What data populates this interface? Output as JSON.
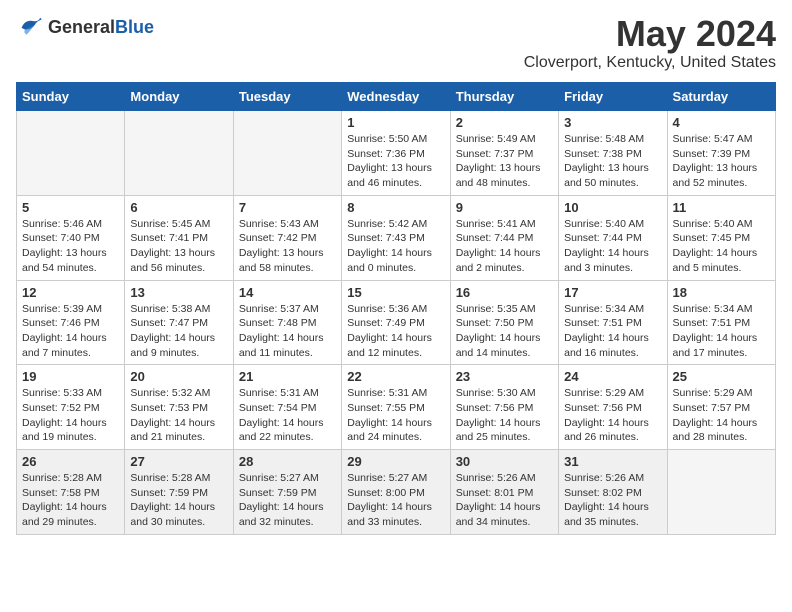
{
  "header": {
    "logo_general": "General",
    "logo_blue": "Blue",
    "month_year": "May 2024",
    "location": "Cloverport, Kentucky, United States"
  },
  "weekdays": [
    "Sunday",
    "Monday",
    "Tuesday",
    "Wednesday",
    "Thursday",
    "Friday",
    "Saturday"
  ],
  "weeks": [
    [
      {
        "day": "",
        "empty": true
      },
      {
        "day": "",
        "empty": true
      },
      {
        "day": "",
        "empty": true
      },
      {
        "day": "1",
        "sunrise": "5:50 AM",
        "sunset": "7:36 PM",
        "daylight": "13 hours and 46 minutes."
      },
      {
        "day": "2",
        "sunrise": "5:49 AM",
        "sunset": "7:37 PM",
        "daylight": "13 hours and 48 minutes."
      },
      {
        "day": "3",
        "sunrise": "5:48 AM",
        "sunset": "7:38 PM",
        "daylight": "13 hours and 50 minutes."
      },
      {
        "day": "4",
        "sunrise": "5:47 AM",
        "sunset": "7:39 PM",
        "daylight": "13 hours and 52 minutes."
      }
    ],
    [
      {
        "day": "5",
        "sunrise": "5:46 AM",
        "sunset": "7:40 PM",
        "daylight": "13 hours and 54 minutes."
      },
      {
        "day": "6",
        "sunrise": "5:45 AM",
        "sunset": "7:41 PM",
        "daylight": "13 hours and 56 minutes."
      },
      {
        "day": "7",
        "sunrise": "5:43 AM",
        "sunset": "7:42 PM",
        "daylight": "13 hours and 58 minutes."
      },
      {
        "day": "8",
        "sunrise": "5:42 AM",
        "sunset": "7:43 PM",
        "daylight": "14 hours and 0 minutes."
      },
      {
        "day": "9",
        "sunrise": "5:41 AM",
        "sunset": "7:44 PM",
        "daylight": "14 hours and 2 minutes."
      },
      {
        "day": "10",
        "sunrise": "5:40 AM",
        "sunset": "7:44 PM",
        "daylight": "14 hours and 3 minutes."
      },
      {
        "day": "11",
        "sunrise": "5:40 AM",
        "sunset": "7:45 PM",
        "daylight": "14 hours and 5 minutes."
      }
    ],
    [
      {
        "day": "12",
        "sunrise": "5:39 AM",
        "sunset": "7:46 PM",
        "daylight": "14 hours and 7 minutes."
      },
      {
        "day": "13",
        "sunrise": "5:38 AM",
        "sunset": "7:47 PM",
        "daylight": "14 hours and 9 minutes."
      },
      {
        "day": "14",
        "sunrise": "5:37 AM",
        "sunset": "7:48 PM",
        "daylight": "14 hours and 11 minutes."
      },
      {
        "day": "15",
        "sunrise": "5:36 AM",
        "sunset": "7:49 PM",
        "daylight": "14 hours and 12 minutes."
      },
      {
        "day": "16",
        "sunrise": "5:35 AM",
        "sunset": "7:50 PM",
        "daylight": "14 hours and 14 minutes."
      },
      {
        "day": "17",
        "sunrise": "5:34 AM",
        "sunset": "7:51 PM",
        "daylight": "14 hours and 16 minutes."
      },
      {
        "day": "18",
        "sunrise": "5:34 AM",
        "sunset": "7:51 PM",
        "daylight": "14 hours and 17 minutes."
      }
    ],
    [
      {
        "day": "19",
        "sunrise": "5:33 AM",
        "sunset": "7:52 PM",
        "daylight": "14 hours and 19 minutes."
      },
      {
        "day": "20",
        "sunrise": "5:32 AM",
        "sunset": "7:53 PM",
        "daylight": "14 hours and 21 minutes."
      },
      {
        "day": "21",
        "sunrise": "5:31 AM",
        "sunset": "7:54 PM",
        "daylight": "14 hours and 22 minutes."
      },
      {
        "day": "22",
        "sunrise": "5:31 AM",
        "sunset": "7:55 PM",
        "daylight": "14 hours and 24 minutes."
      },
      {
        "day": "23",
        "sunrise": "5:30 AM",
        "sunset": "7:56 PM",
        "daylight": "14 hours and 25 minutes."
      },
      {
        "day": "24",
        "sunrise": "5:29 AM",
        "sunset": "7:56 PM",
        "daylight": "14 hours and 26 minutes."
      },
      {
        "day": "25",
        "sunrise": "5:29 AM",
        "sunset": "7:57 PM",
        "daylight": "14 hours and 28 minutes."
      }
    ],
    [
      {
        "day": "26",
        "sunrise": "5:28 AM",
        "sunset": "7:58 PM",
        "daylight": "14 hours and 29 minutes.",
        "lastrow": true
      },
      {
        "day": "27",
        "sunrise": "5:28 AM",
        "sunset": "7:59 PM",
        "daylight": "14 hours and 30 minutes.",
        "lastrow": true
      },
      {
        "day": "28",
        "sunrise": "5:27 AM",
        "sunset": "7:59 PM",
        "daylight": "14 hours and 32 minutes.",
        "lastrow": true
      },
      {
        "day": "29",
        "sunrise": "5:27 AM",
        "sunset": "8:00 PM",
        "daylight": "14 hours and 33 minutes.",
        "lastrow": true
      },
      {
        "day": "30",
        "sunrise": "5:26 AM",
        "sunset": "8:01 PM",
        "daylight": "14 hours and 34 minutes.",
        "lastrow": true
      },
      {
        "day": "31",
        "sunrise": "5:26 AM",
        "sunset": "8:02 PM",
        "daylight": "14 hours and 35 minutes.",
        "lastrow": true
      },
      {
        "day": "",
        "empty": true,
        "lastrow": true
      }
    ]
  ],
  "labels": {
    "sunrise": "Sunrise:",
    "sunset": "Sunset:",
    "daylight": "Daylight:"
  }
}
